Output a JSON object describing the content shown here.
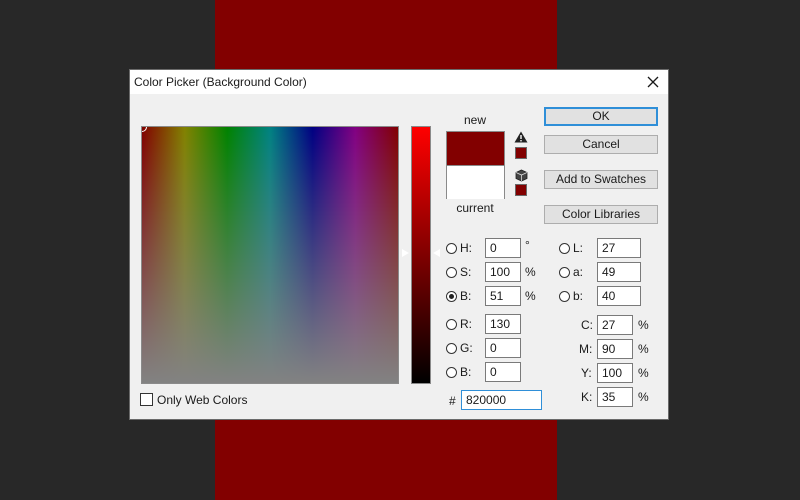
{
  "dialog": {
    "title": "Color Picker (Background Color)",
    "only_web_colors_label": "Only Web Colors",
    "only_web_colors_checked": false
  },
  "preview": {
    "new_label": "new",
    "current_label": "current",
    "new_color": "#820000",
    "current_color": "#ffffff"
  },
  "buttons": {
    "ok": "OK",
    "cancel": "Cancel",
    "add_to_swatches": "Add to Swatches",
    "color_libraries": "Color Libraries"
  },
  "hsb": {
    "h_label": "H:",
    "h_value": "0",
    "h_unit": "°",
    "s_label": "S:",
    "s_value": "100",
    "s_unit": "%",
    "b_label": "B:",
    "b_value": "51",
    "b_unit": "%"
  },
  "rgb": {
    "r_label": "R:",
    "r_value": "130",
    "g_label": "G:",
    "g_value": "0",
    "b_label": "B:",
    "b_value": "0"
  },
  "lab": {
    "l_label": "L:",
    "l_value": "27",
    "a_label": "a:",
    "a_value": "49",
    "b_label": "b:",
    "b_value": "40"
  },
  "cmyk": {
    "c_label": "C:",
    "c_value": "27",
    "m_label": "M:",
    "m_value": "90",
    "y_label": "Y:",
    "y_value": "100",
    "k_label": "K:",
    "k_value": "35",
    "unit": "%"
  },
  "hex": {
    "label": "#",
    "value": "820000"
  },
  "selected_mode": "B",
  "colors": {
    "background_color": "#820000",
    "accent": "#2f8fd8"
  },
  "icons": [
    "close-icon",
    "gamut-warning-icon",
    "web-safe-cube-icon"
  ]
}
